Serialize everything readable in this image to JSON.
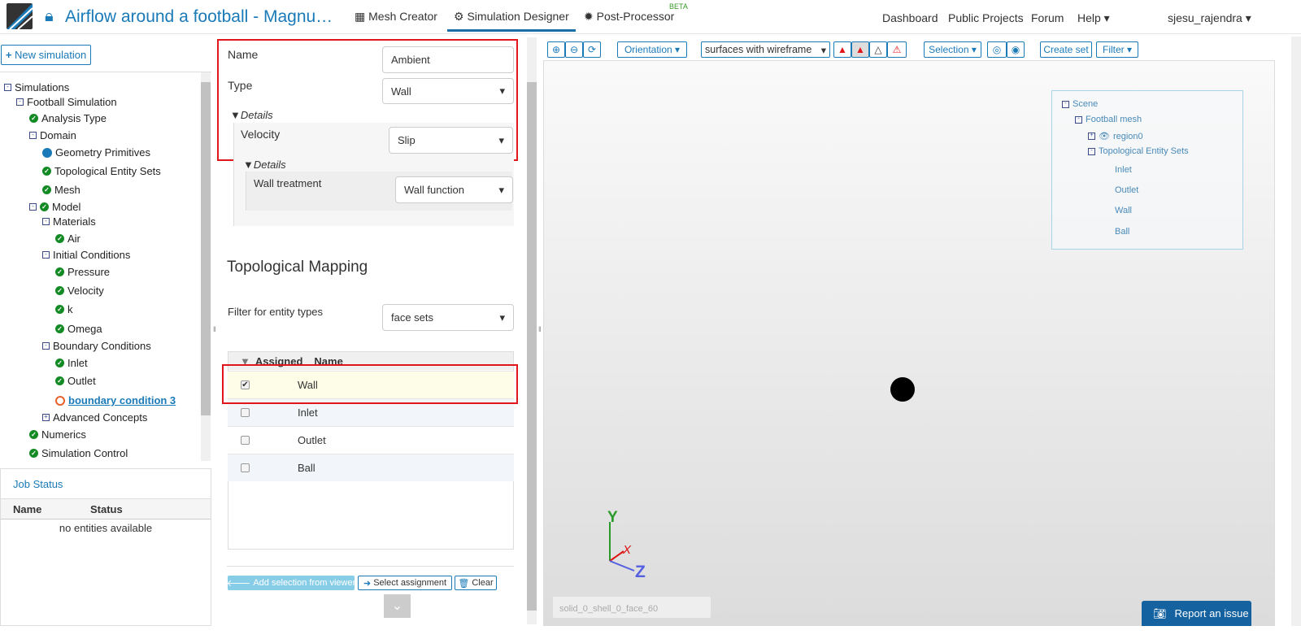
{
  "header": {
    "title": "Airflow around a football - Magnu…",
    "nav": [
      {
        "label": "Mesh Creator",
        "icon": "grid-icon"
      },
      {
        "label": "Simulation Designer",
        "icon": "gears-icon"
      },
      {
        "label": "Post-Processor",
        "icon": "cog-icon"
      }
    ],
    "beta": "BETA",
    "right": [
      "Dashboard",
      "Public Projects",
      "Forum",
      "Help"
    ],
    "user": "sjesu_rajendra"
  },
  "left": {
    "new_sim": "New simulation",
    "tree": [
      {
        "label": "Simulations",
        "lvl": 0,
        "icon": "minus"
      },
      {
        "label": "Football Simulation",
        "lvl": 1,
        "icon": "minus"
      },
      {
        "label": "Analysis Type",
        "lvl": 2,
        "icon": "check"
      },
      {
        "label": "Domain",
        "lvl": 2,
        "icon": "minus"
      },
      {
        "label": "Geometry Primitives",
        "lvl": 3,
        "icon": "dot"
      },
      {
        "label": "Topological Entity Sets",
        "lvl": 3,
        "icon": "check"
      },
      {
        "label": "Mesh",
        "lvl": 3,
        "icon": "check"
      },
      {
        "label": "Model",
        "lvl": 2,
        "icon": "minuscheck"
      },
      {
        "label": "Materials",
        "lvl": 3,
        "icon": "minus"
      },
      {
        "label": "Air",
        "lvl": 4,
        "icon": "check"
      },
      {
        "label": "Initial Conditions",
        "lvl": 3,
        "icon": "minus"
      },
      {
        "label": "Pressure",
        "lvl": 4,
        "icon": "check"
      },
      {
        "label": "Velocity",
        "lvl": 4,
        "icon": "check"
      },
      {
        "label": "k",
        "lvl": 4,
        "icon": "check"
      },
      {
        "label": "Omega",
        "lvl": 4,
        "icon": "check"
      },
      {
        "label": "Boundary Conditions",
        "lvl": 3,
        "icon": "minus"
      },
      {
        "label": "Inlet",
        "lvl": 4,
        "icon": "check"
      },
      {
        "label": "Outlet",
        "lvl": 4,
        "icon": "check"
      },
      {
        "label": "boundary condition 3",
        "lvl": 4,
        "icon": "ring"
      },
      {
        "label": "Advanced Concepts",
        "lvl": 3,
        "icon": "plus"
      },
      {
        "label": "Numerics",
        "lvl": 2,
        "icon": "check"
      },
      {
        "label": "Simulation Control",
        "lvl": 2,
        "icon": "check"
      }
    ],
    "job_status": {
      "title": "Job Status",
      "cols": [
        "Name",
        "Status"
      ],
      "empty": "no entities available"
    }
  },
  "form": {
    "name_label": "Name",
    "name_value": "Ambient",
    "type_label": "Type",
    "type_value": "Wall",
    "details": "Details",
    "velocity_label": "Velocity",
    "velocity_value": "Slip",
    "details2": "Details",
    "wall_treatment_label": "Wall treatment",
    "wall_treatment_value": "Wall function",
    "mapping_title": "Topological Mapping",
    "filter_label": "Filter for entity types",
    "filter_value": "face sets",
    "table_cols": [
      "Assigned",
      "Name"
    ],
    "rows": [
      {
        "name": "Wall",
        "checked": true
      },
      {
        "name": "Inlet",
        "checked": false
      },
      {
        "name": "Outlet",
        "checked": false
      },
      {
        "name": "Ball",
        "checked": false
      }
    ],
    "add_selection": "Add selection from viewer",
    "select_assignment": "Select assignment",
    "clear": "Clear"
  },
  "viewer": {
    "orientation": "Orientation",
    "render_mode": "surfaces with wireframe",
    "selection": "Selection",
    "create_set": "Create set",
    "filter": "Filter",
    "scene_tree": [
      {
        "label": "Scene",
        "lvl": 0
      },
      {
        "label": "Football mesh",
        "lvl": 1
      },
      {
        "label": "region0",
        "lvl": 2
      },
      {
        "label": "Topological Entity Sets",
        "lvl": 2
      },
      {
        "label": "Inlet",
        "lvl": 3
      },
      {
        "label": "Outlet",
        "lvl": 3
      },
      {
        "label": "Wall",
        "lvl": 3
      },
      {
        "label": "Ball",
        "lvl": 3
      }
    ],
    "status_field": "solid_0_shell_0_face_60",
    "report": "Report an issue",
    "axes": {
      "x": "X",
      "y": "Y",
      "z": "Z"
    }
  }
}
